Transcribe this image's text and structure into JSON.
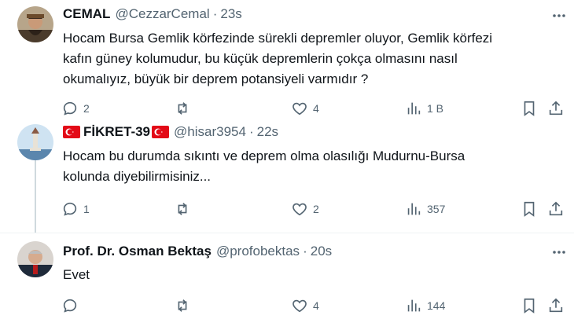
{
  "colors": {
    "text": "#0f1419",
    "muted": "#536471",
    "flag": "#e30a17",
    "line": "#cfd9de"
  },
  "tweets": [
    {
      "name": "CEMAL",
      "handle": "@CezzarCemal",
      "time": "23s",
      "text_lines": [
        "Hocam Bursa Gemlik körfezinde sürekli depremler oluyor, Gemlik körfezi",
        "kafın güney kolumudur, bu küçük depremlerin çokça olmasını nasıl",
        "okumalıyız, büyük bir deprem potansiyeli varmıdır ?"
      ],
      "replies": "2",
      "reposts": "",
      "likes": "4",
      "views": "1 B"
    },
    {
      "name_prefix_flag": "flag-icon",
      "name": "FİKRET-39",
      "handle": "@hisar3954",
      "time": "22s",
      "text_lines": [
        "Hocam bu durumda sıkıntı ve deprem olma olasılığı Mudurnu-Bursa",
        "kolunda diyebilirmisiniz..."
      ],
      "replies": "1",
      "reposts": "",
      "likes": "2",
      "views": "357"
    },
    {
      "name": "Prof. Dr. Osman Bektaş",
      "handle": "@profobektas",
      "time": "20s",
      "text_lines": [
        "Evet"
      ],
      "replies": "",
      "reposts": "",
      "likes": "4",
      "views": "144"
    }
  ],
  "sep": "·"
}
